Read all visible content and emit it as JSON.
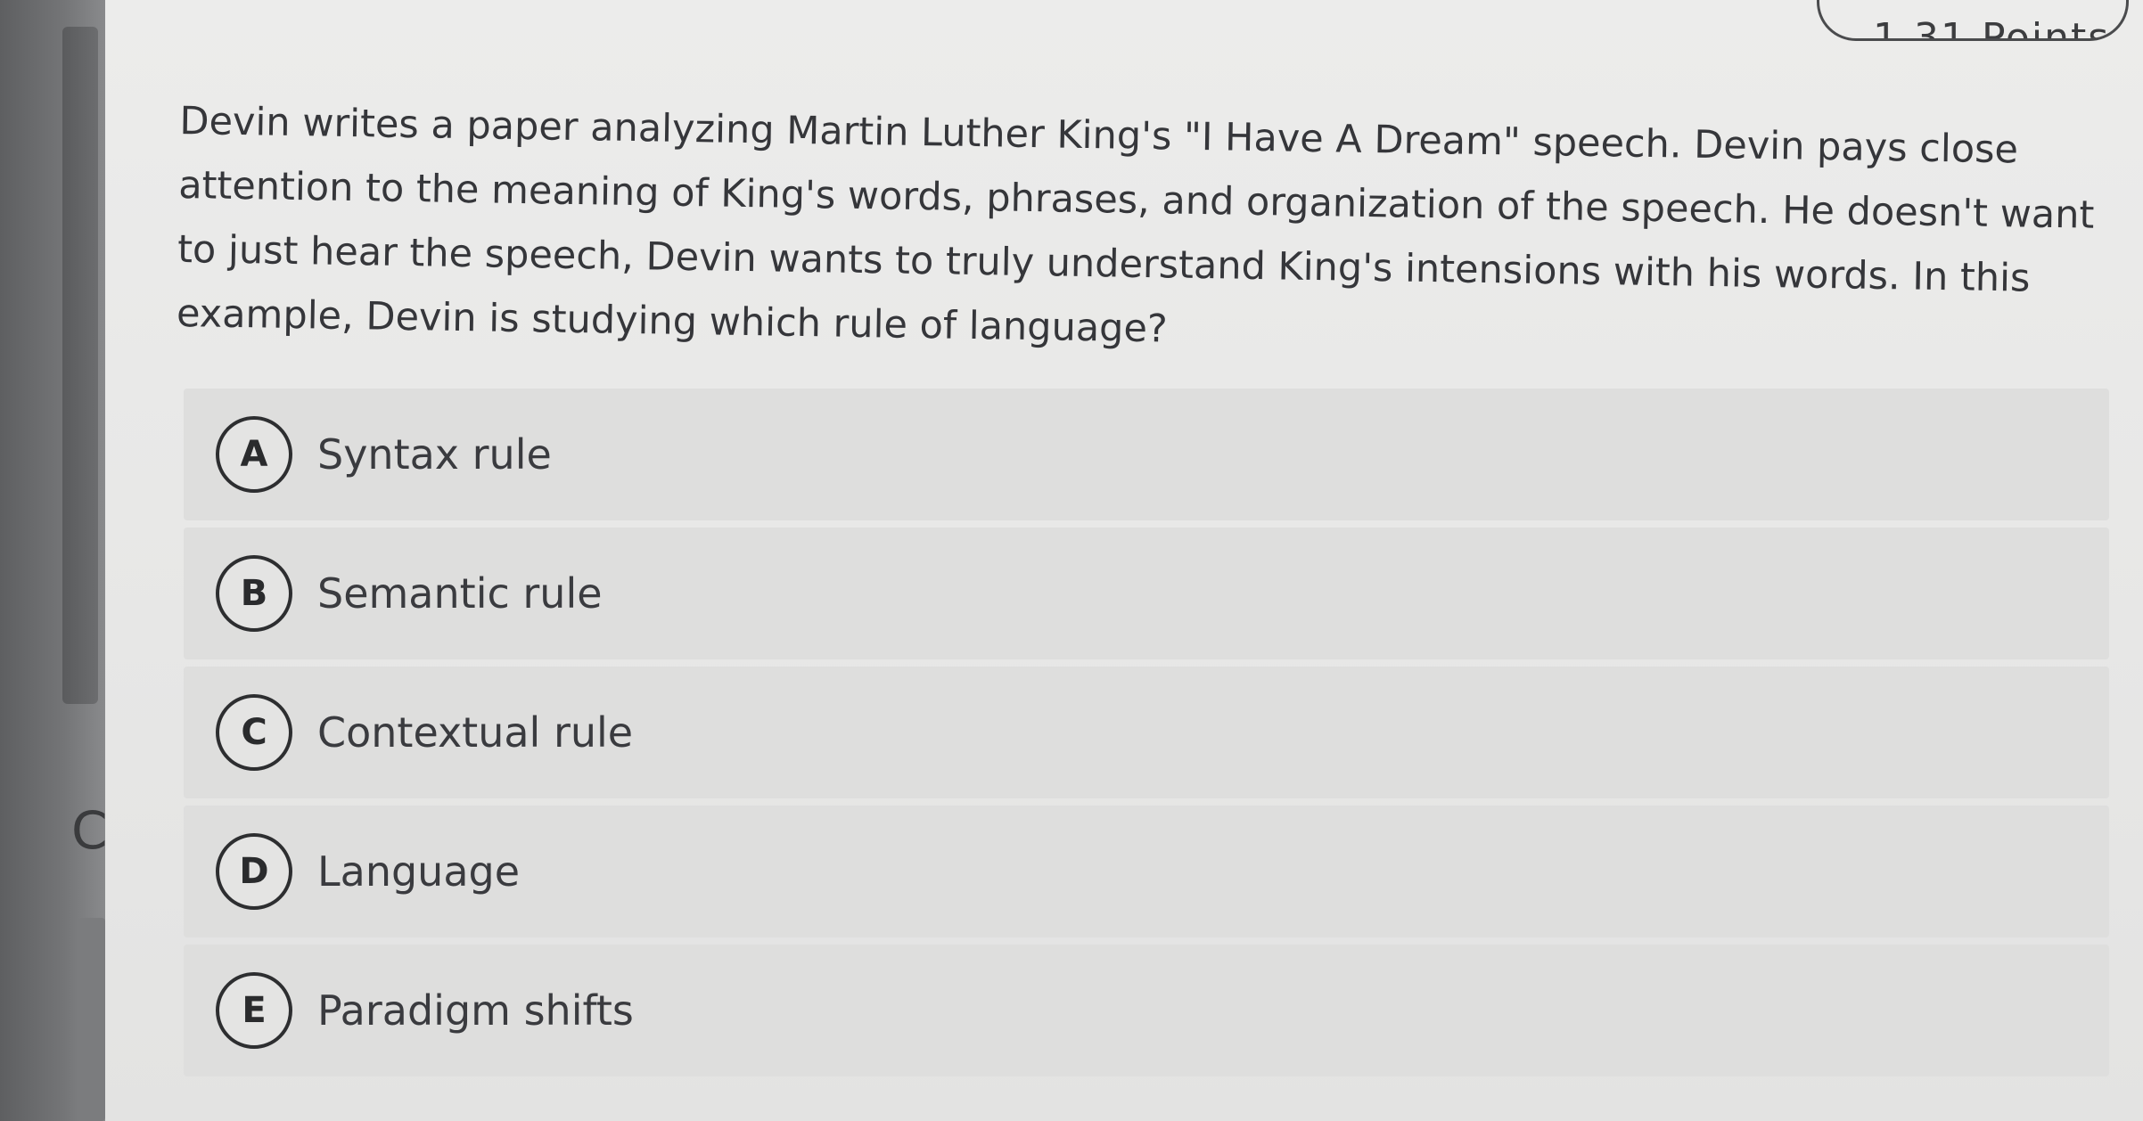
{
  "points_label": "1.31 Points",
  "left_edge_glyph": "C",
  "question": "Devin writes a paper analyzing Martin Luther King's \"I Have A Dream\" speech. Devin pays close attention to the meaning of King's words, phrases, and organization of the speech. He doesn't want to just hear the speech, Devin wants to truly understand King's intensions with his words. In this example, Devin is studying which rule of language?",
  "choices": [
    {
      "letter": "A",
      "label": "Syntax rule"
    },
    {
      "letter": "B",
      "label": "Semantic rule"
    },
    {
      "letter": "C",
      "label": "Contextual rule"
    },
    {
      "letter": "D",
      "label": "Language"
    },
    {
      "letter": "E",
      "label": "Paradigm shifts"
    }
  ]
}
